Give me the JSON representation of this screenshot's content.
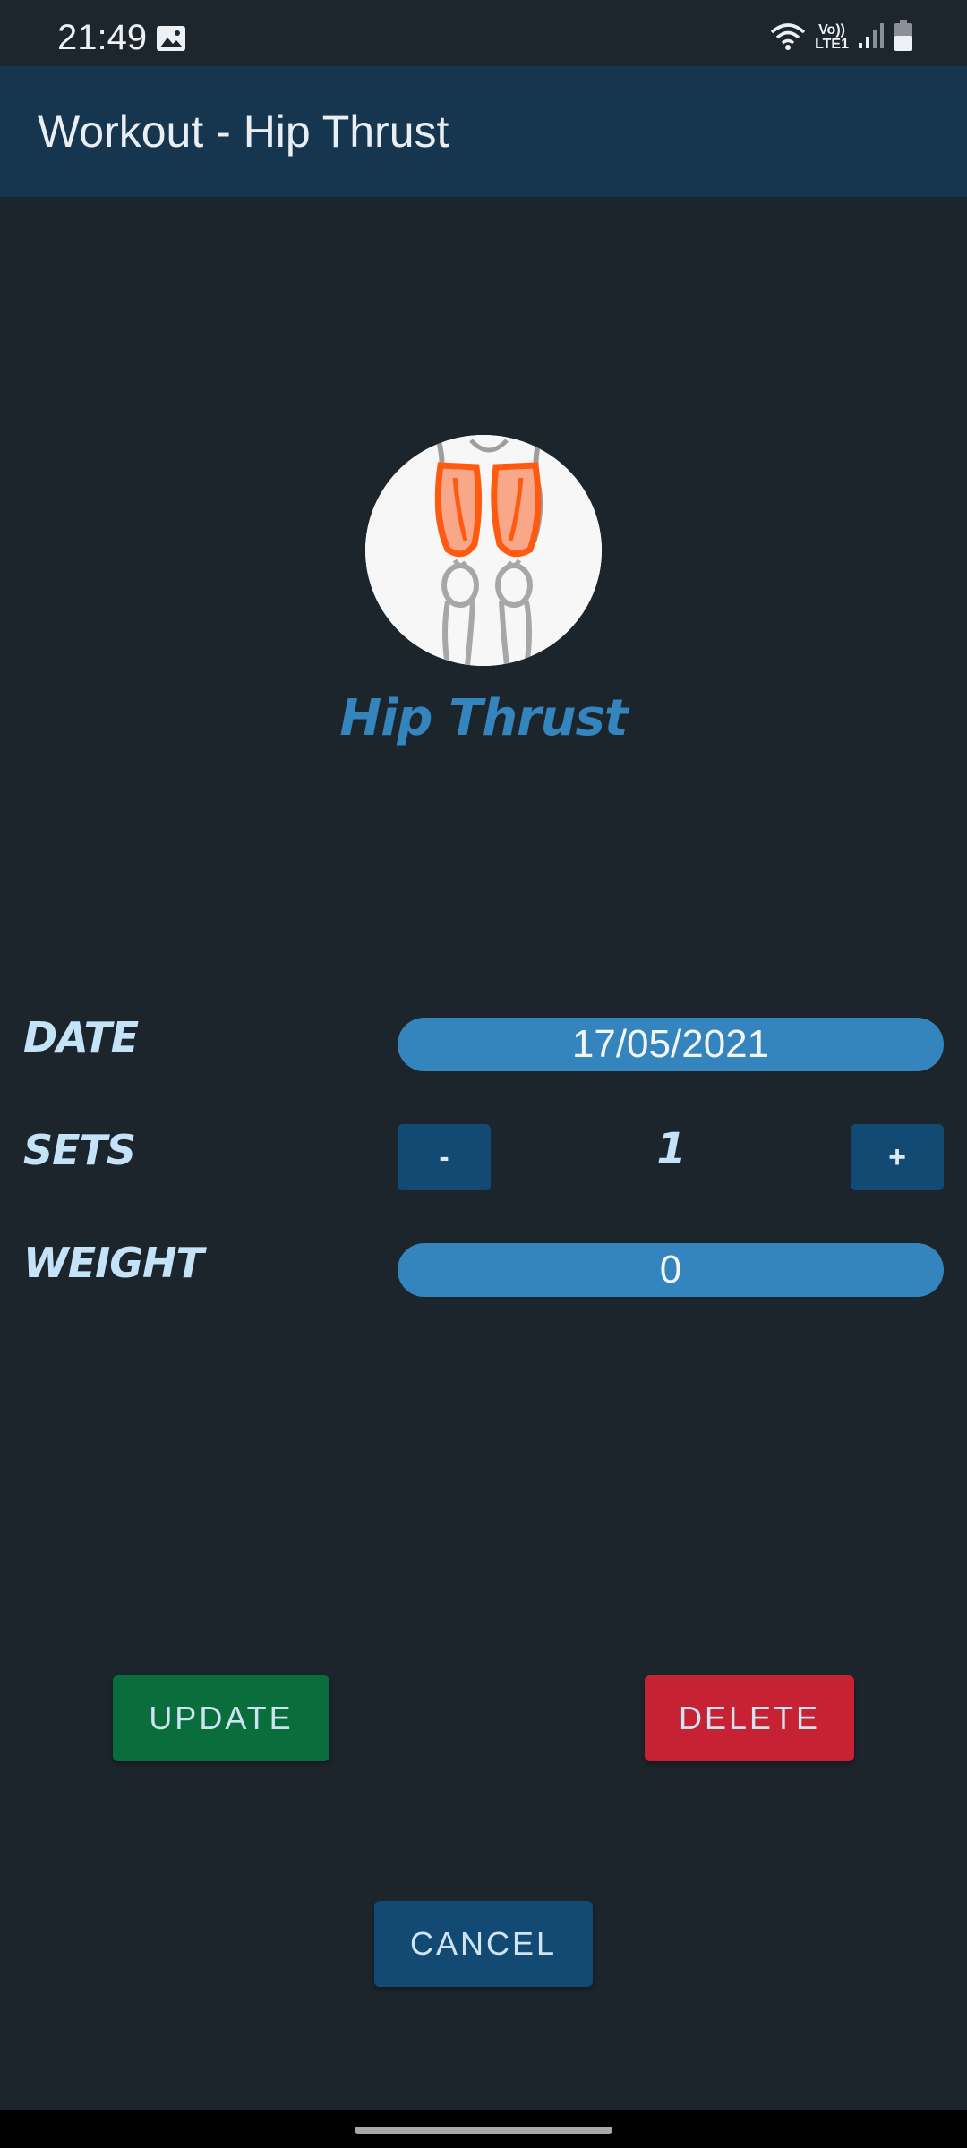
{
  "status_bar": {
    "time": "21:49",
    "volte_line1": "Vo))",
    "volte_line2": "LTE1",
    "icons": [
      "image-icon",
      "wifi-icon",
      "signal-icon",
      "battery-icon"
    ]
  },
  "app_bar": {
    "title": "Workout - Hip Thrust"
  },
  "exercise": {
    "name": "Hip Thrust",
    "image_icon": "hip-thrust-muscle-illustration"
  },
  "form": {
    "date_label": "DATE",
    "date_value": "17/05/2021",
    "sets_label": "SETS",
    "sets_decrement": "-",
    "sets_value": "1",
    "sets_increment": "+",
    "weight_label": "WEIGHT",
    "weight_value": "0"
  },
  "actions": {
    "update_label": "UPDATE",
    "delete_label": "DELETE",
    "cancel_label": "CANCEL"
  },
  "colors": {
    "background": "#1d252c",
    "app_bar": "#16354f",
    "accent": "#3485be",
    "label": "#c5e3f8",
    "stepper": "#134a73",
    "update": "#0a6d3c",
    "delete": "#c62233",
    "cancel": "#134a73",
    "muscle_highlight": "#ff5a10"
  }
}
